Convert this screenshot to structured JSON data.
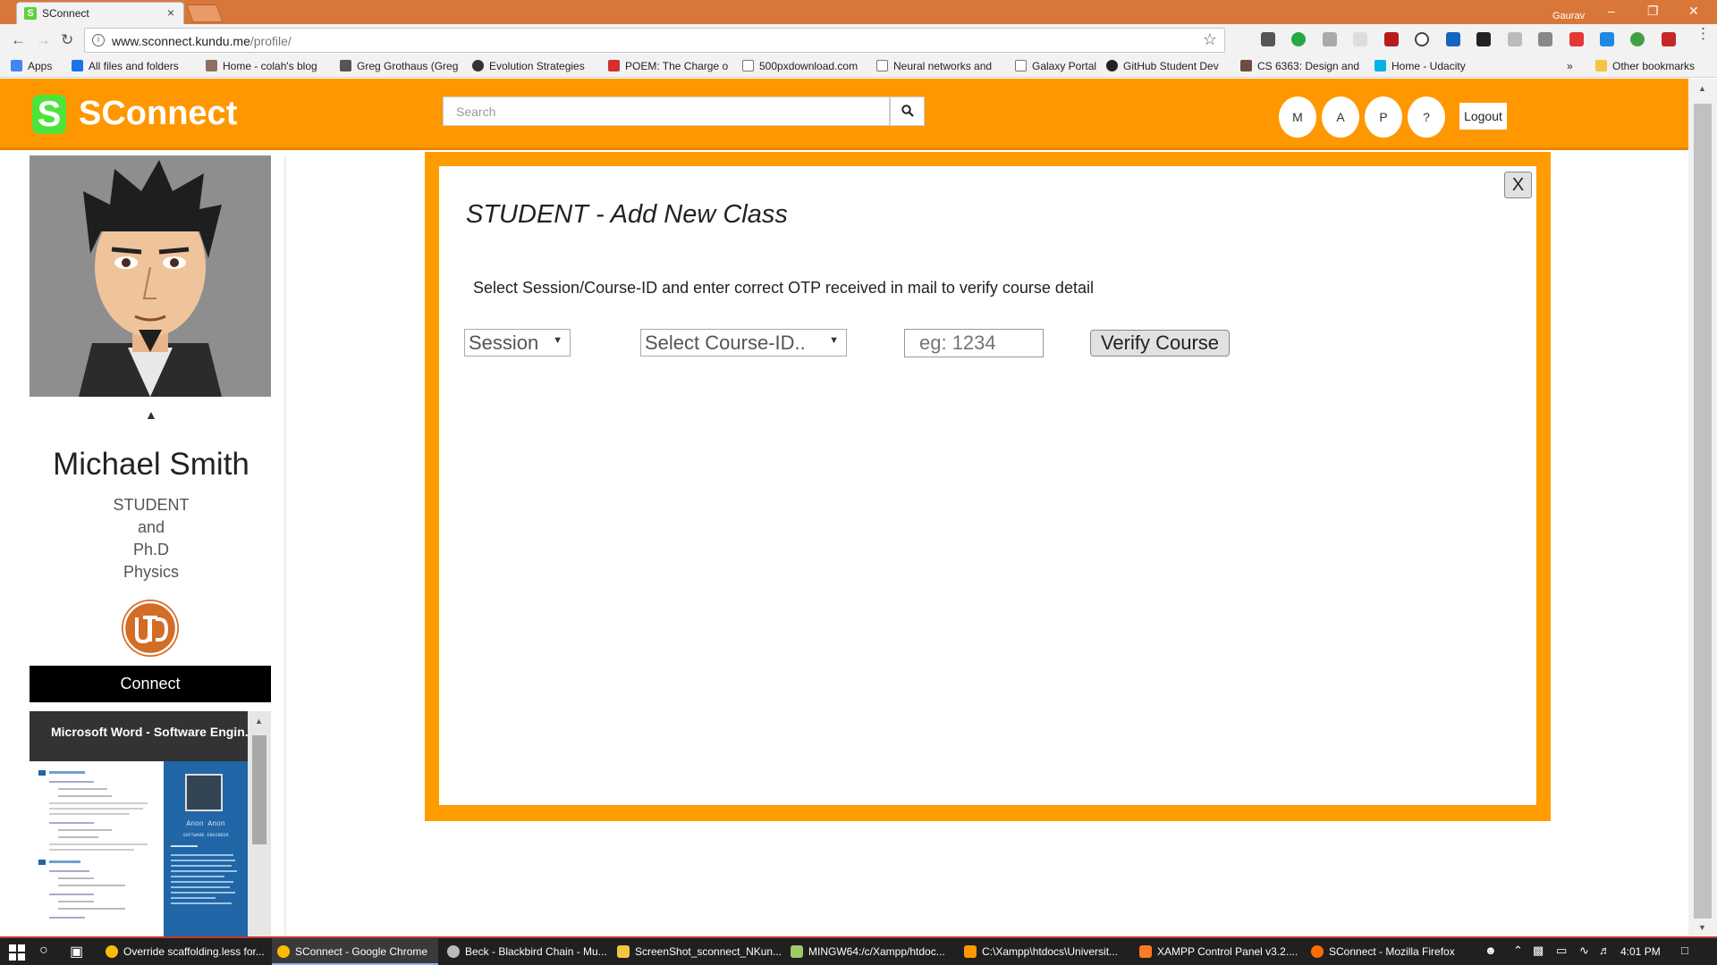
{
  "browser": {
    "tab_title": "SConnect",
    "tab_close": "×",
    "user": "Gaurav",
    "url_host": "www.sconnect.kundu.me",
    "url_path": "/profile/",
    "bookmarks": [
      "Apps",
      "All files and folders",
      "Home - colah's blog",
      "Greg Grothaus (Greg",
      "Evolution Strategies",
      "POEM: The Charge o",
      "500pxdownload.com",
      "Neural networks and",
      "Galaxy Portal",
      "GitHub Student Dev",
      "CS 6363: Design and",
      "Home - Udacity"
    ],
    "overflow": "»",
    "other_bookmarks": "Other bookmarks"
  },
  "header": {
    "logo_mark": "S",
    "logo_text": "SConnect",
    "search_placeholder": "Search",
    "circle_buttons": [
      "M",
      "A",
      "P",
      "?"
    ],
    "logout": "Logout"
  },
  "profile": {
    "name": "Michael Smith",
    "role_lines": [
      "STUDENT",
      "and",
      "Ph.D",
      "Physics"
    ],
    "connect": "Connect",
    "doc_title": "Microsoft Word - Software Engin...",
    "doc_person": "Anon Anon",
    "doc_person_title": "SOFTWARE ENGINEER"
  },
  "modal": {
    "close": "X",
    "title": "STUDENT - Add New Class",
    "instruction": "Select Session/Course-ID and enter correct OTP received in mail to verify course detail",
    "session_select": "Session",
    "course_select": "Select Course-ID..",
    "otp_placeholder": "eg: 1234",
    "verify": "Verify Course"
  },
  "taskbar": {
    "tasks": [
      "Override scaffolding.less for...",
      "SConnect - Google Chrome",
      "Beck - Blackbird Chain - Mu...",
      "ScreenShot_sconnect_NKun...",
      "MINGW64:/c/Xampp/htdoc...",
      "C:\\Xampp\\htdocs\\Universit...",
      "XAMPP Control Panel v3.2....",
      "SConnect - Mozilla Firefox"
    ],
    "time": "4:01 PM"
  },
  "colors": {
    "header": "#ff9800",
    "modal_border": "#ff9c00",
    "logo_green": "#4ee33b",
    "chrome_title": "#d9773a"
  }
}
